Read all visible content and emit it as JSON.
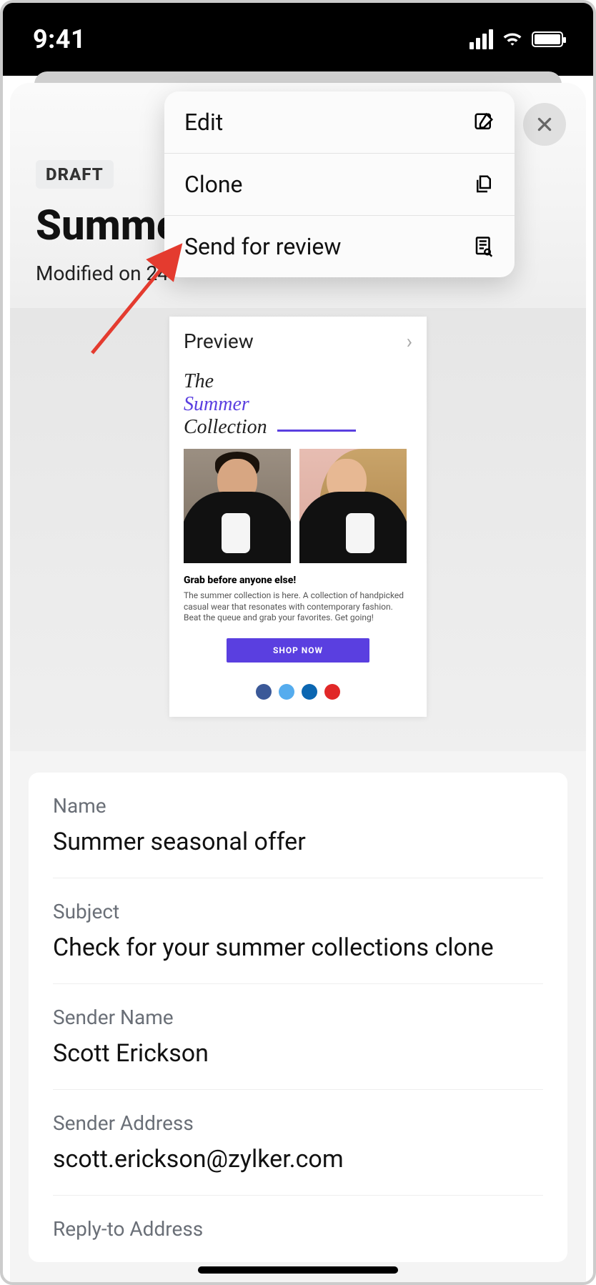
{
  "statusbar": {
    "time": "9:41"
  },
  "header": {
    "badge": "DRAFT",
    "title": "Summer seasonal offer",
    "modified": "Modified on 24"
  },
  "menu": {
    "edit": "Edit",
    "clone": "Clone",
    "send_for_review": "Send for review"
  },
  "preview": {
    "label": "Preview",
    "t1": "The",
    "t2": "Summer",
    "t3": "Collection",
    "headline": "Grab before anyone else!",
    "body": "The summer collection is here. A collection of handpicked casual wear that resonates with contemporary fashion. Beat the queue and grab your favorites. Get going!",
    "cta": "SHOP NOW"
  },
  "fields": {
    "name_label": "Name",
    "name_value": "Summer seasonal offer",
    "subject_label": "Subject",
    "subject_value": "Check for your summer collections clone",
    "sender_name_label": "Sender Name",
    "sender_name_value": "Scott Erickson",
    "sender_address_label": "Sender Address",
    "sender_address_value": "scott.erickson@zylker.com",
    "reply_to_label": "Reply-to Address"
  }
}
